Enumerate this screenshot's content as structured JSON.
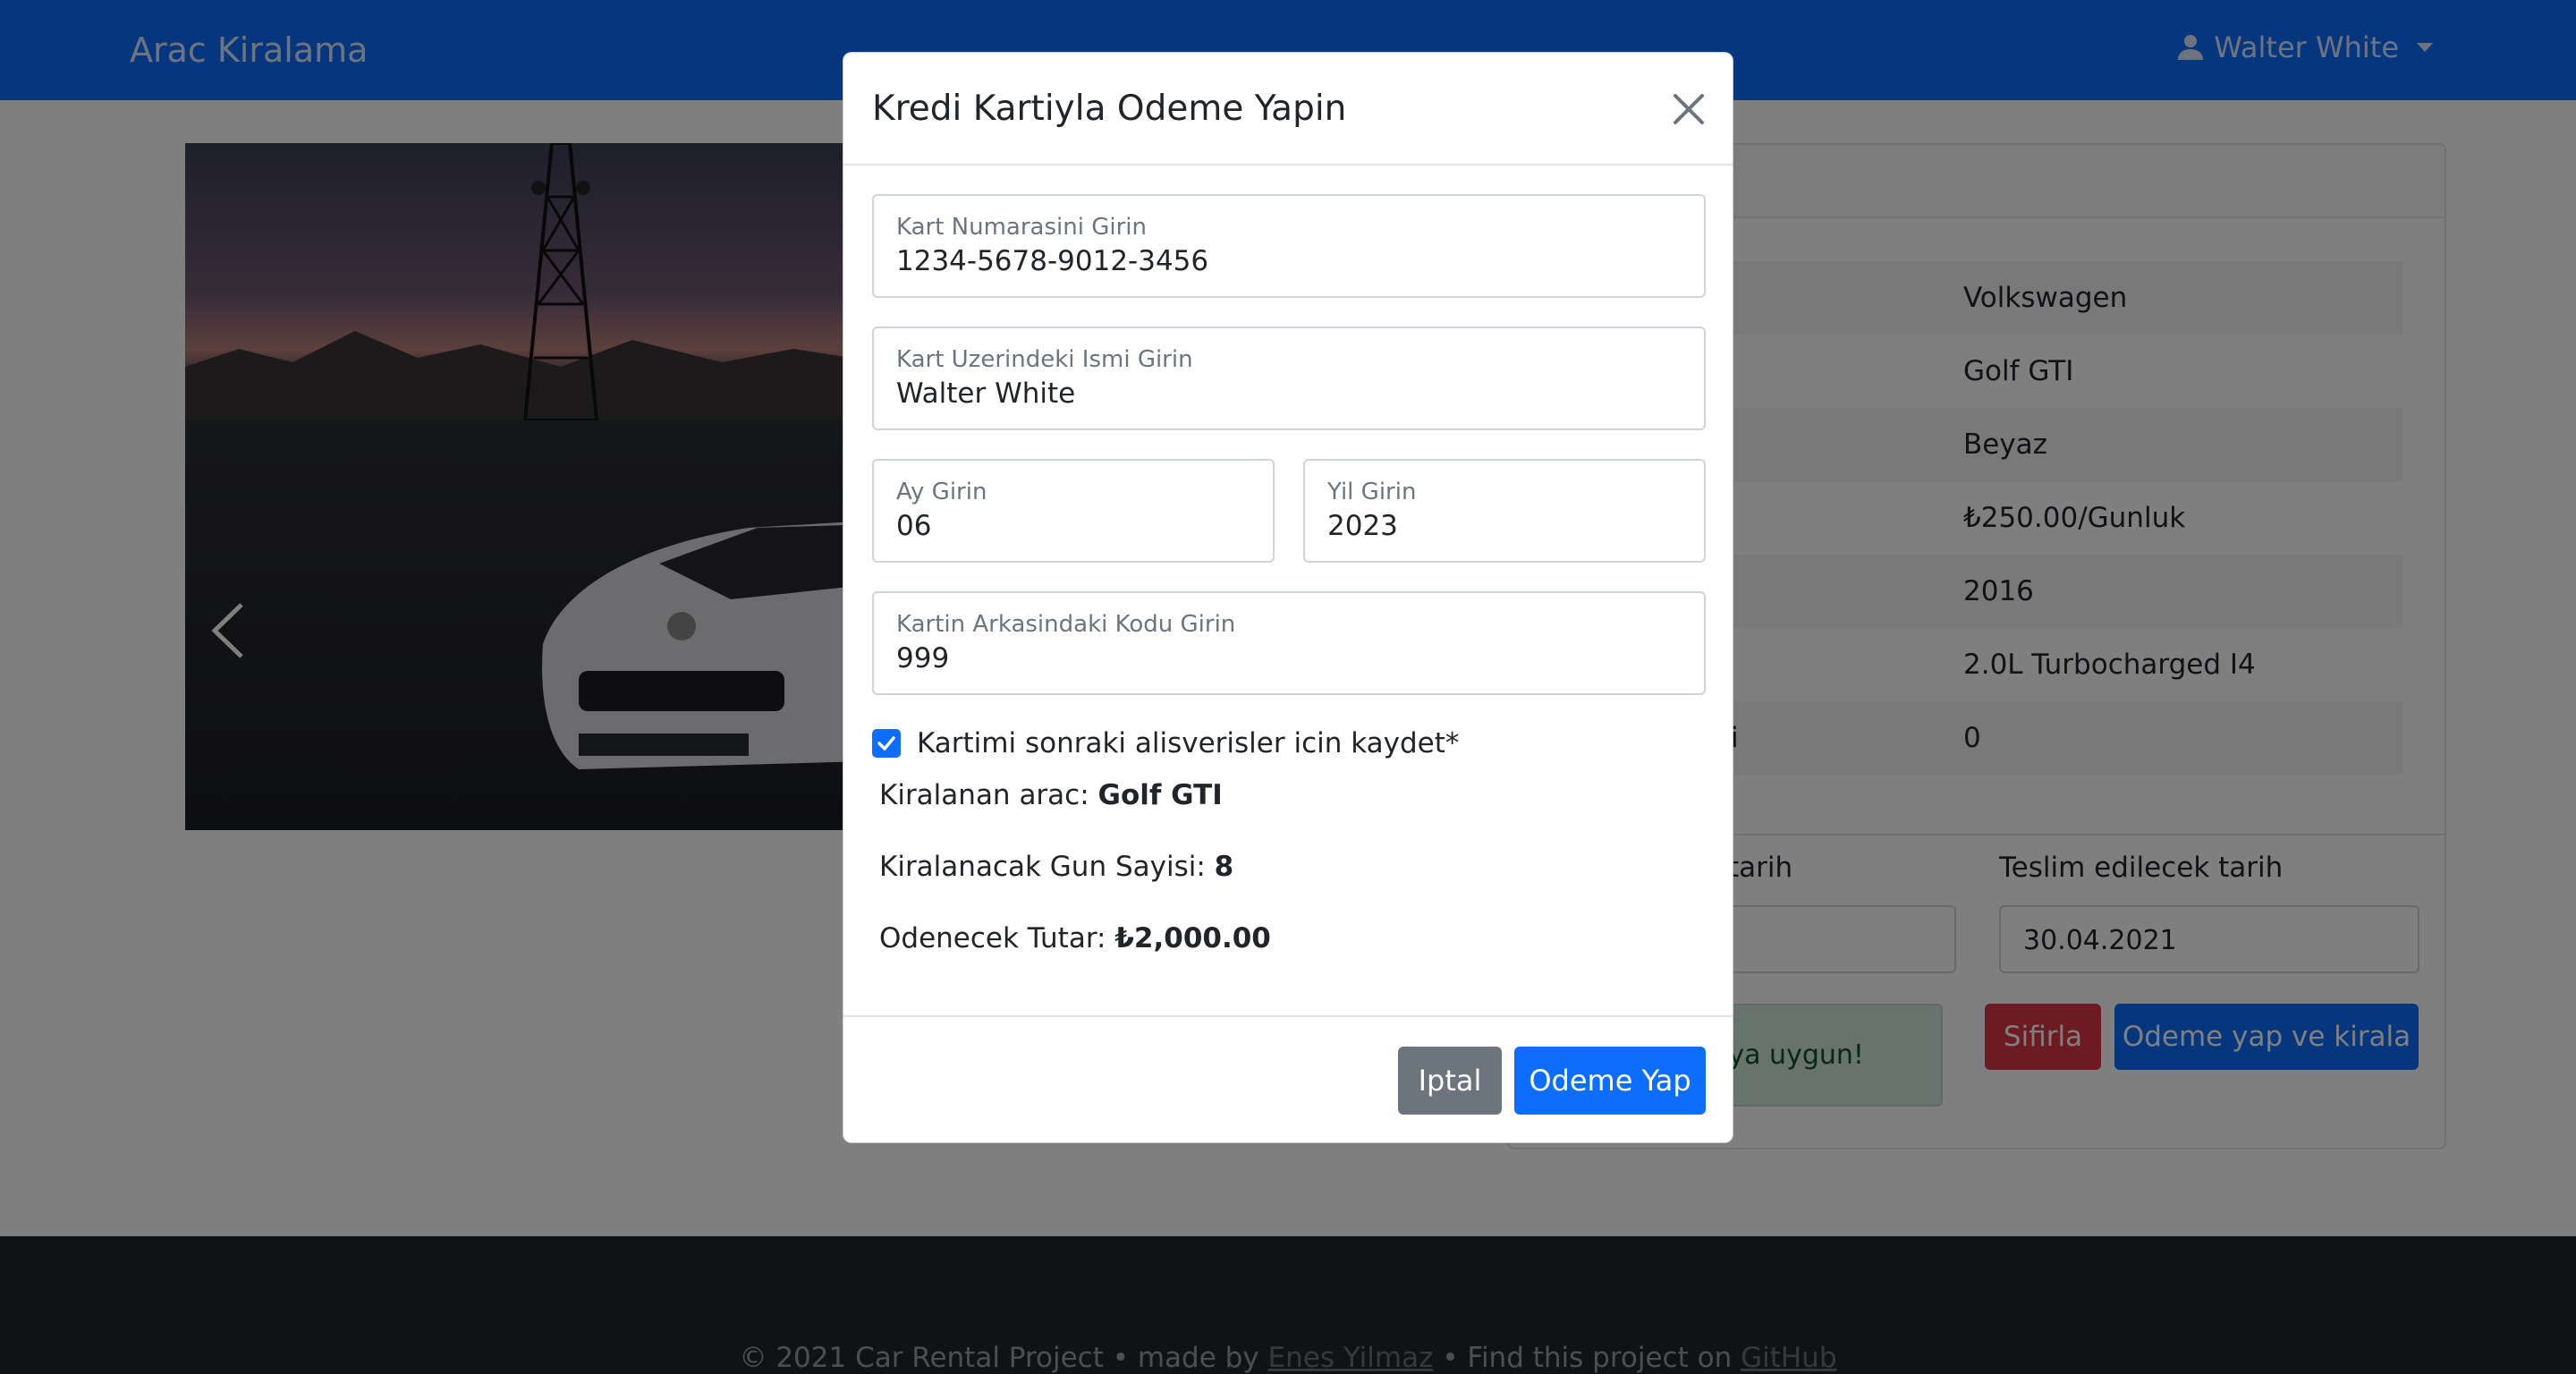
{
  "navbar": {
    "brand": "Arac Kiralama",
    "user_name": "Walter White",
    "icons": [
      "user-icon",
      "caret-down-icon"
    ],
    "color": "#0d6efd"
  },
  "car_details": [
    {
      "label": "",
      "value": "Volkswagen"
    },
    {
      "label": "",
      "value": "Golf GTI"
    },
    {
      "label": "",
      "value": "Beyaz"
    },
    {
      "label": "",
      "value": "₺250.00/Gunluk"
    },
    {
      "label": "",
      "value": "2016"
    },
    {
      "label": "",
      "value": "2.0L Turbocharged I4"
    },
    {
      "label": "i",
      "value": "0"
    }
  ],
  "rental_form": {
    "start_label_partial": "tarih",
    "end_label": "Teslim edilecek tarih",
    "end_value": "30.04.2021",
    "availability_partial": "aya uygun!",
    "reset_button": "Sifirla",
    "pay_and_rent_button": "Odeme yap ve kirala"
  },
  "modal": {
    "title": "Kredi Kartiyla Odeme Yapin",
    "fields": {
      "card_number": {
        "label": "Kart Numarasini Girin",
        "value": "1234-5678-9012-3456"
      },
      "card_name": {
        "label": "Kart Uzerindeki Ismi Girin",
        "value": "Walter White"
      },
      "month": {
        "label": "Ay Girin",
        "value": "06"
      },
      "year": {
        "label": "Yil Girin",
        "value": "2023"
      },
      "cvv": {
        "label": "Kartin Arkasindaki Kodu Girin",
        "value": "999"
      }
    },
    "save_card": {
      "label": "Kartimi sonraki alisverisler icin kaydet*",
      "checked": true
    },
    "summary": {
      "car_label": "Kiralanan arac:",
      "car_value": "Golf GTI",
      "days_label": "Kiralanacak Gun Sayisi:",
      "days_value": "8",
      "amount_label": "Odenecek Tutar:",
      "amount_value": "₺2,000.00"
    },
    "cancel_button": "Iptal",
    "pay_button": "Odeme Yap"
  },
  "footer": {
    "text_prefix": "© 2021 Car Rental Project • made by ",
    "author": "Enes Yilmaz",
    "text_middle": " • Find this project on ",
    "repo_link": "GitHub"
  }
}
